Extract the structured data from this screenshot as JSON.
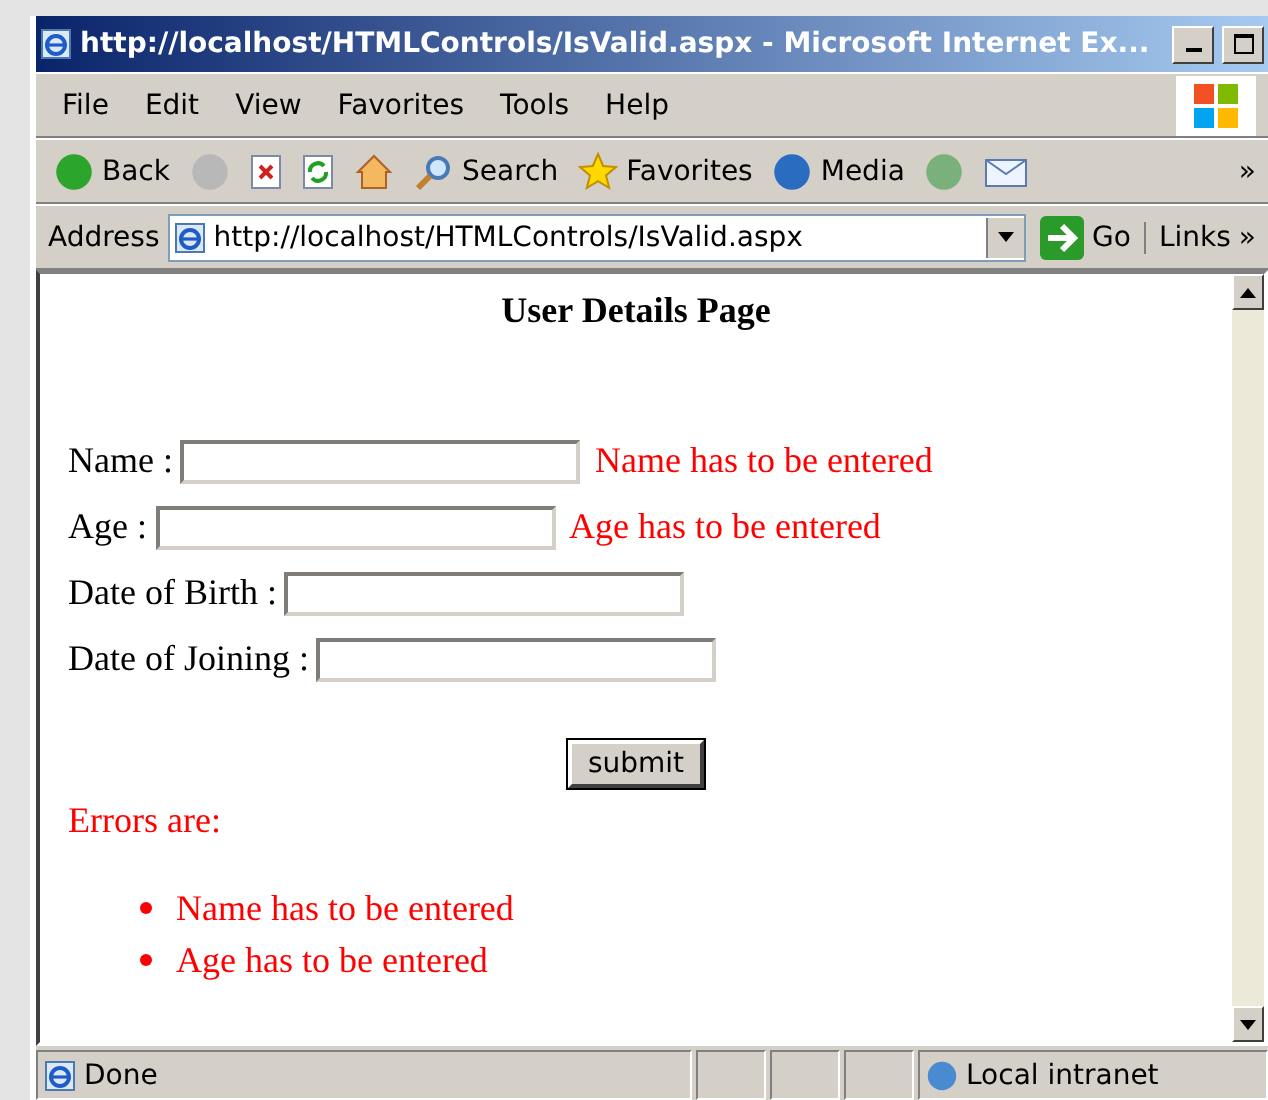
{
  "window": {
    "title": "http://localhost/HTMLControls/IsValid.aspx - Microsoft Internet Ex..."
  },
  "menu": [
    "File",
    "Edit",
    "View",
    "Favorites",
    "Tools",
    "Help"
  ],
  "toolbar": [
    {
      "kind": "back",
      "label": "Back"
    },
    {
      "kind": "forward"
    },
    {
      "kind": "stop"
    },
    {
      "kind": "refresh"
    },
    {
      "kind": "home"
    },
    {
      "kind": "search",
      "label": "Search"
    },
    {
      "kind": "favorites",
      "label": "Favorites"
    },
    {
      "kind": "media",
      "label": "Media"
    },
    {
      "kind": "history"
    },
    {
      "kind": "mail"
    }
  ],
  "overflow": "»",
  "address": {
    "label": "Address",
    "value": "http://localhost/HTMLControls/IsValid.aspx",
    "go": "Go",
    "links": "Links",
    "links_more": "»"
  },
  "page": {
    "heading": "User Details Page",
    "fields": [
      {
        "label": "Name :",
        "error": "Name has to be entered"
      },
      {
        "label": "Age :",
        "error": "Age has to be entered"
      },
      {
        "label": "Date of Birth :"
      },
      {
        "label": "Date of Joining :"
      }
    ],
    "submit": "submit",
    "errors_title": "Errors are:",
    "errors": [
      "Name has to be entered",
      "Age has to be entered"
    ]
  },
  "status_bar": {
    "text": "Done",
    "zone": "Local intranet"
  }
}
